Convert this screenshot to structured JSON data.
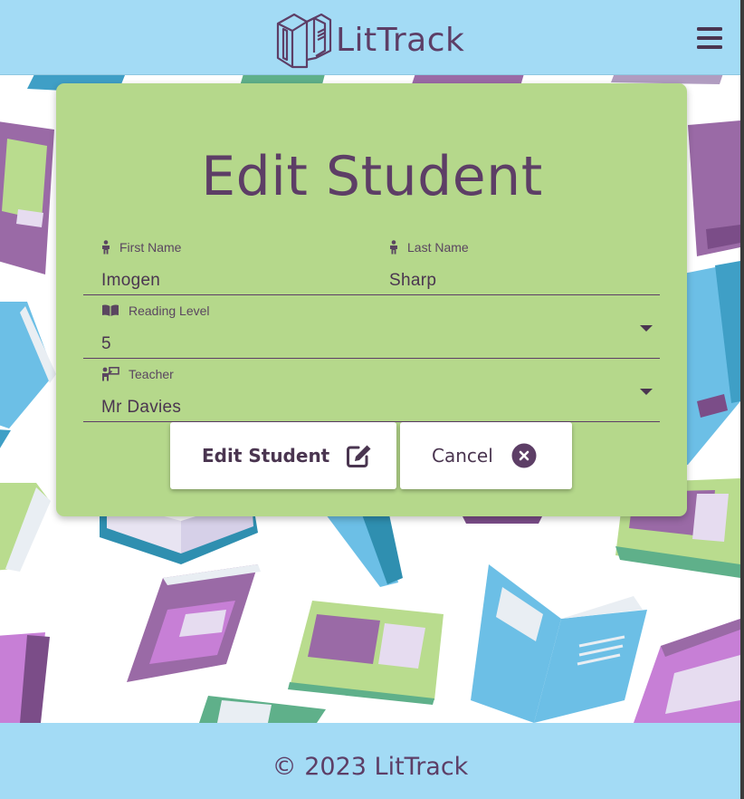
{
  "app": {
    "name": "LitTrack"
  },
  "header": {
    "menu_icon": "hamburger-menu-icon"
  },
  "form": {
    "title": "Edit Student",
    "first_name": {
      "label": "First Name",
      "value": "Imogen",
      "icon": "person-icon"
    },
    "last_name": {
      "label": "Last Name",
      "value": "Sharp",
      "icon": "person-icon"
    },
    "reading_level": {
      "label": "Reading Level",
      "value": "5",
      "icon": "book-icon"
    },
    "teacher": {
      "label": "Teacher",
      "value": "Mr Davies",
      "icon": "teacher-icon"
    },
    "submit_label": "Edit Student",
    "cancel_label": "Cancel"
  },
  "footer": {
    "text": "© 2023 LitTrack"
  },
  "colors": {
    "header_bg": "#a3dbf5",
    "card_bg": "#b5d88b",
    "text_purple": "#5d3e66",
    "book_blue": "#6cbfe6",
    "book_green": "#b9dc8e",
    "book_purple": "#9a6aa6",
    "book_pink": "#c77fd6"
  }
}
